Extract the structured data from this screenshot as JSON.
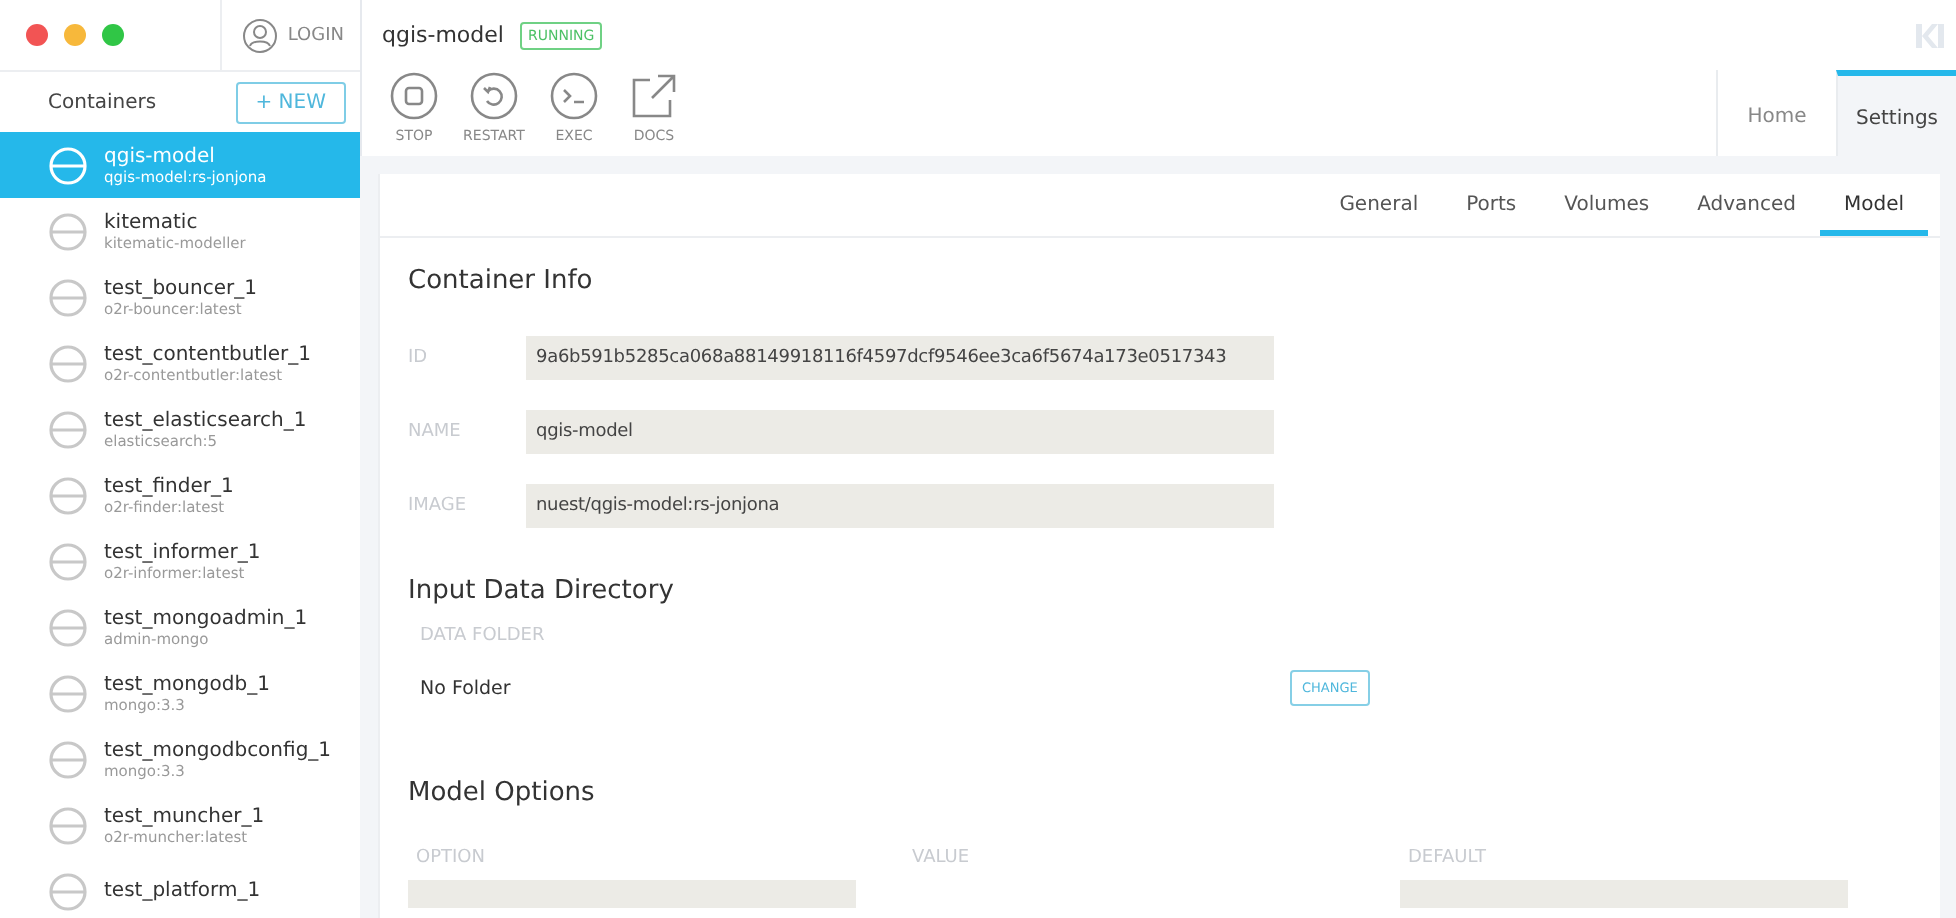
{
  "sidebar": {
    "login": "LOGIN",
    "title": "Containers",
    "new_button": "+ NEW",
    "containers": [
      {
        "name": "qgis-model",
        "image": "qgis-model:rs-jonjona",
        "selected": true
      },
      {
        "name": "kitematic",
        "image": "kitematic-modeller",
        "selected": false
      },
      {
        "name": "test_bouncer_1",
        "image": "o2r-bouncer:latest",
        "selected": false
      },
      {
        "name": "test_contentbutler_1",
        "image": "o2r-contentbutler:latest",
        "selected": false
      },
      {
        "name": "test_elasticsearch_1",
        "image": "elasticsearch:5",
        "selected": false
      },
      {
        "name": "test_finder_1",
        "image": "o2r-finder:latest",
        "selected": false
      },
      {
        "name": "test_informer_1",
        "image": "o2r-informer:latest",
        "selected": false
      },
      {
        "name": "test_mongoadmin_1",
        "image": "admin-mongo",
        "selected": false
      },
      {
        "name": "test_mongodb_1",
        "image": "mongo:3.3",
        "selected": false
      },
      {
        "name": "test_mongodbconfig_1",
        "image": "mongo:3.3",
        "selected": false
      },
      {
        "name": "test_muncher_1",
        "image": "o2r-muncher:latest",
        "selected": false
      },
      {
        "name": "test_platform_1",
        "selected": false
      }
    ]
  },
  "header": {
    "title": "qgis-model",
    "status": "RUNNING",
    "actions": [
      {
        "kind": "stop",
        "label": "STOP"
      },
      {
        "kind": "restart",
        "label": "RESTART"
      },
      {
        "kind": "exec",
        "label": "EXEC"
      },
      {
        "kind": "docs",
        "label": "DOCS"
      }
    ],
    "tabs": [
      {
        "label": "Home",
        "selected": false
      },
      {
        "label": "Settings",
        "selected": true
      }
    ]
  },
  "subtabs": [
    {
      "label": "General",
      "selected": false
    },
    {
      "label": "Ports",
      "selected": false
    },
    {
      "label": "Volumes",
      "selected": false
    },
    {
      "label": "Advanced",
      "selected": false
    },
    {
      "label": "Model",
      "selected": true
    }
  ],
  "container_info": {
    "title": "Container Info",
    "fields": [
      {
        "label": "ID",
        "value": "9a6b591b5285ca068a88149918116f4597dcf9546ee3ca6f5674a173e0517343"
      },
      {
        "label": "NAME",
        "value": "qgis-model"
      },
      {
        "label": "IMAGE",
        "value": "nuest/qgis-model:rs-jonjona"
      }
    ]
  },
  "input_data": {
    "title": "Input Data Directory",
    "label": "DATA FOLDER",
    "value": "No Folder",
    "button": "CHANGE"
  },
  "model_options": {
    "title": "Model Options",
    "columns": [
      "OPTION",
      "VALUE",
      "DEFAULT"
    ]
  }
}
